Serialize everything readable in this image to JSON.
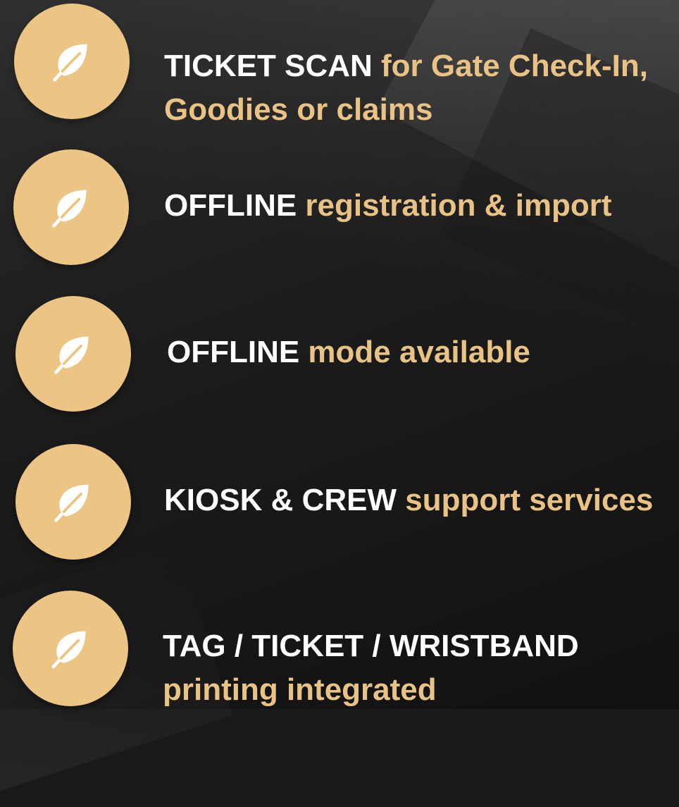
{
  "colors": {
    "accent": "#ECC483",
    "highlight": "#FFFFFF",
    "text_accent": "#E9C285"
  },
  "icon": "leaf-icon",
  "features": [
    {
      "strong": "TICKET SCAN",
      "rest_line1": " for Gate Check-In,",
      "rest_line2": "Goodies or claims"
    },
    {
      "strong": "OFFLINE",
      "rest_line1": " registration & import"
    },
    {
      "strong": "OFFLINE",
      "rest_line1": " mode available"
    },
    {
      "strong": "KIOSK & CREW",
      "rest_line1": " support services"
    },
    {
      "strong": "TAG / TICKET / WRISTBAND",
      "rest_line2": "printing integrated"
    }
  ]
}
